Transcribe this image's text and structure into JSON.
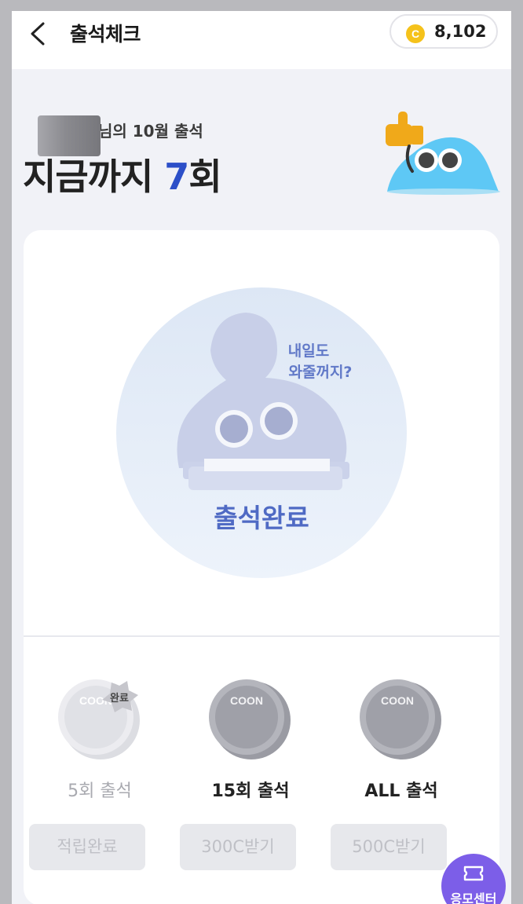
{
  "header": {
    "title": "출석체크",
    "coin_balance": "8,102",
    "coin_symbol": "C"
  },
  "summary": {
    "subtitle": "님의 10월 출석",
    "count_prefix": "지금까지 ",
    "count_value": "7",
    "count_suffix": "회"
  },
  "stamp": {
    "bubble_line1": "내일도",
    "bubble_line2": "와줄꺼지?",
    "status": "출석완료"
  },
  "rewards": [
    {
      "label": "5회 출석",
      "button": "적립완료",
      "badge": "완료",
      "coin_text": "COON",
      "completed": true
    },
    {
      "label": "15회 출석",
      "button": "300C받기",
      "coin_text": "COON",
      "completed": false
    },
    {
      "label": "ALL 출석",
      "button": "500C받기",
      "coin_text": "COON",
      "completed": false
    }
  ],
  "fab": {
    "label": "응모센터",
    "icon": "ticket-icon"
  },
  "colors": {
    "accent": "#2c4fc8",
    "fab": "#7c5ee8",
    "coin": "#f5c21b"
  }
}
